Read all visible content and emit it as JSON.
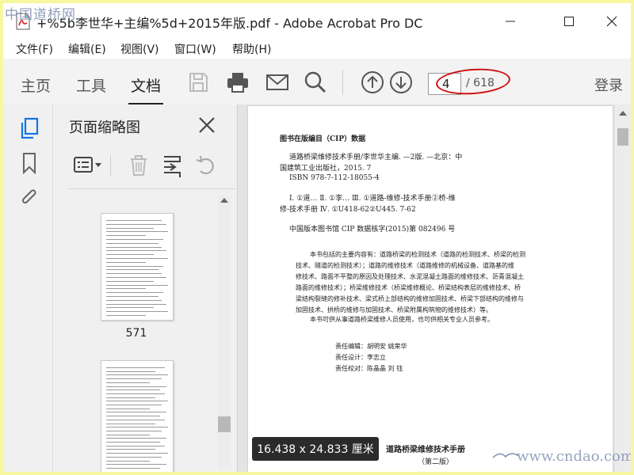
{
  "watermarks": {
    "top_left": "中国道桥网",
    "bottom_right": "www.cndao.com"
  },
  "window": {
    "title": "+%5b李世华+主编%5d+2015年版.pdf - Adobe Acrobat Pro DC",
    "app_icon": "acrobat-pdf-icon"
  },
  "menu": [
    "文件(F)",
    "编辑(E)",
    "视图(V)",
    "窗口(W)",
    "帮助(H)"
  ],
  "toolbar": {
    "tabs": [
      "主页",
      "工具",
      "文档"
    ],
    "active_tab": "文档",
    "current_page": "4",
    "total_pages": "/ 618",
    "login": "登录",
    "annotation_color": "#d01010"
  },
  "thumbnail_panel": {
    "title": "页面缩略图",
    "thumbnails": [
      {
        "label": "571"
      },
      {
        "label": ""
      }
    ]
  },
  "document": {
    "lines": [
      "图书在版编目（CIP）数据",
      "道路桥梁维修技术手册/李世华主编. —2版. —北京：中",
      "国建筑工业出版社，2015. 7",
      "ISBN 978-7-112-18055-4",
      "Ⅰ. ①道…   Ⅱ. ①李…   Ⅲ. ①道路-维修-技术手册②桥-维",
      "修-技术手册   Ⅳ. ①U418-62②U445. 7-62",
      "中国版本图书馆 CIP 数据核字(2015)第 082496 号",
      "本书包括的主要内容有：道路桥梁的检测技术（道路的检测技术、桥梁的检测",
      "技术、隧道的检测技术）；道路的维修技术（道路维修的机械设备、道路基的维",
      "修技术、路面不平整的原因及处理技术、水泥混凝土路面的维修技术、沥青混凝土",
      "路面的维修技术）；桥梁维修技术（桥梁维修概论、桥梁结构表层的维修技术、桥",
      "梁结构裂缝的修补技术、梁式桥上部结构的维修加固技术、桥梁下部结构的维修与",
      "加固技术、拱桥的维修与加固技术、桥梁附属构筑物的维修技术）等。",
      "本书可供从事道路桥梁维修人员使用，也可供相关专业人员参考。",
      "责任编辑：胡明安   姚荣华",
      "责任设计：李志立",
      "责任校对：陈晶晶   刘   钰",
      "道路桥梁维修技术手册",
      "（第二版）"
    ],
    "page_size_tooltip": "16.438 x 24.833 厘米"
  }
}
